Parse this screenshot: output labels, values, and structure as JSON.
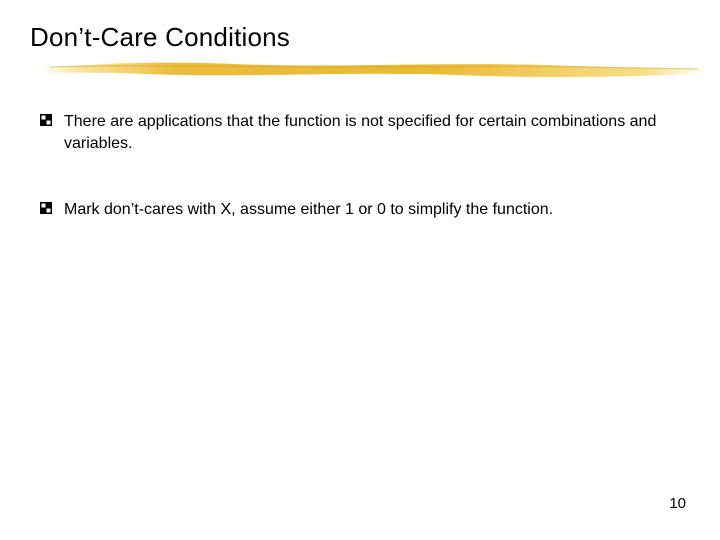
{
  "slide": {
    "title": "Don’t-Care Conditions",
    "bullets": [
      {
        "text": "There are applications that the function is not specified for certain combinations and variables."
      },
      {
        "text": "Mark don’t-cares with X, assume either 1 or 0 to simplify the function."
      }
    ],
    "page_number": "10"
  },
  "glossary": {
    "bullet_icon": "decorative-square-bullet"
  }
}
